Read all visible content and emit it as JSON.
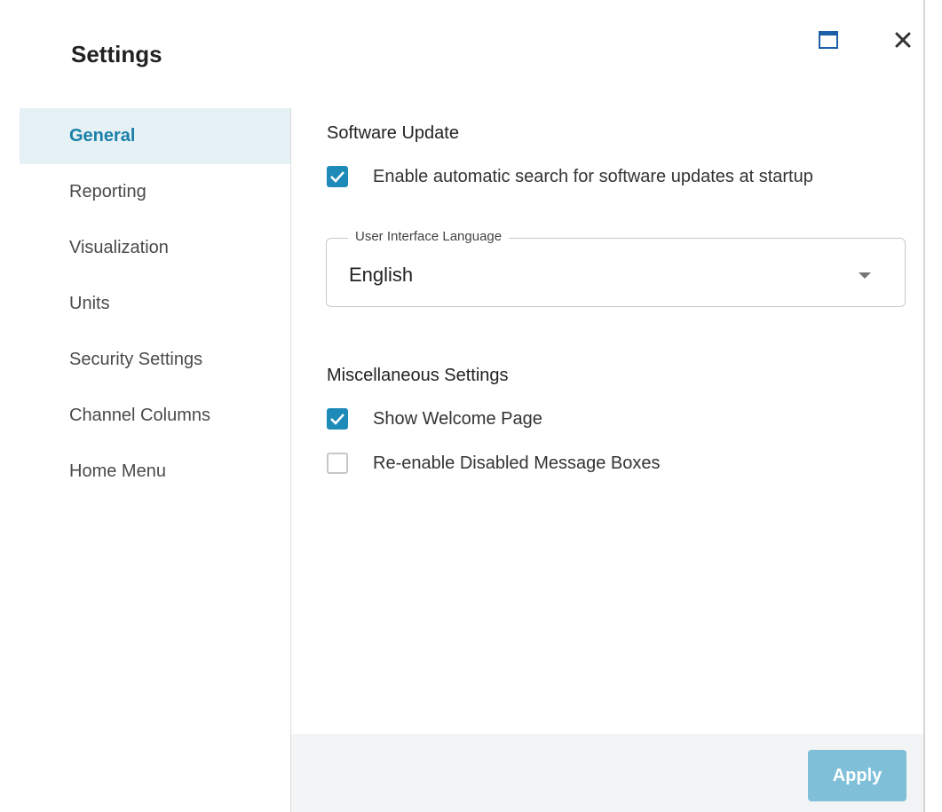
{
  "dialog": {
    "title": "Settings"
  },
  "window_controls": {
    "maximize_icon": "maximize-icon",
    "close_icon": "close-icon"
  },
  "sidebar": {
    "items": [
      {
        "label": "General",
        "active": true
      },
      {
        "label": "Reporting",
        "active": false
      },
      {
        "label": "Visualization",
        "active": false
      },
      {
        "label": "Units",
        "active": false
      },
      {
        "label": "Security Settings",
        "active": false
      },
      {
        "label": "Channel Columns",
        "active": false
      },
      {
        "label": "Home Menu",
        "active": false
      }
    ]
  },
  "software_update": {
    "title": "Software Update",
    "auto_search": {
      "label": "Enable automatic search for software updates at startup",
      "checked": true
    }
  },
  "language": {
    "legend": "User Interface Language",
    "value": "English"
  },
  "misc": {
    "title": "Miscellaneous Settings",
    "welcome_page": {
      "label": "Show Welcome Page",
      "checked": true
    },
    "reenable_boxes": {
      "label": "Re-enable Disabled Message Boxes",
      "checked": false
    }
  },
  "footer": {
    "apply_label": "Apply"
  },
  "colors": {
    "accent": "#1d8ab8",
    "active_nav_bg": "#e6f1f6",
    "active_nav_text": "#1a7fa8",
    "apply_button": "#7fbfd8",
    "footer_bg": "#f3f4f5"
  }
}
